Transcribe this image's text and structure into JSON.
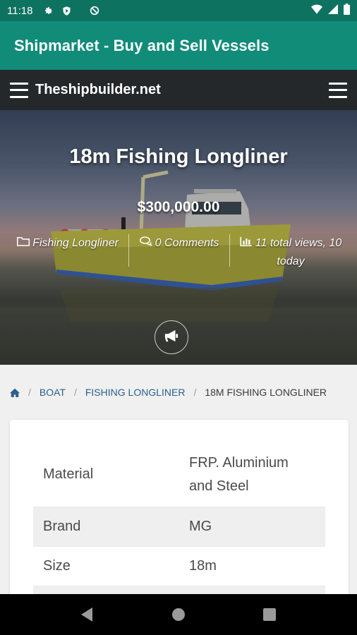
{
  "status_bar": {
    "time": "11:18",
    "icons": [
      "gear-icon",
      "shield-play-icon",
      "no-sync-icon",
      "wifi-icon",
      "signal-icon",
      "battery-icon"
    ]
  },
  "app_bar": {
    "title": "Shipmarket - Buy and Sell Vessels"
  },
  "site_header": {
    "site_name": "Theshipbuilder.net"
  },
  "hero": {
    "title": "18m Fishing Longliner",
    "price": "$300,000.00",
    "category": "Fishing Longliner",
    "comments": "0 Comments",
    "views": "11 total views, 10 today"
  },
  "breadcrumb": {
    "items": [
      "BOAT",
      "FISHING LONGLINER"
    ],
    "current": "18M FISHING LONGLINER"
  },
  "specs": [
    {
      "label": "Material",
      "value": "FRP. Aluminium and Steel"
    },
    {
      "label": "Brand",
      "value": "MG"
    },
    {
      "label": "Size",
      "value": "18m"
    },
    {
      "label": "",
      "value": ""
    }
  ],
  "colors": {
    "status_bar": "#0e7261",
    "app_bar": "#118c79",
    "site_header": "#25282b",
    "link": "#2b5f8e",
    "boat_hull": "#c6c23a"
  }
}
